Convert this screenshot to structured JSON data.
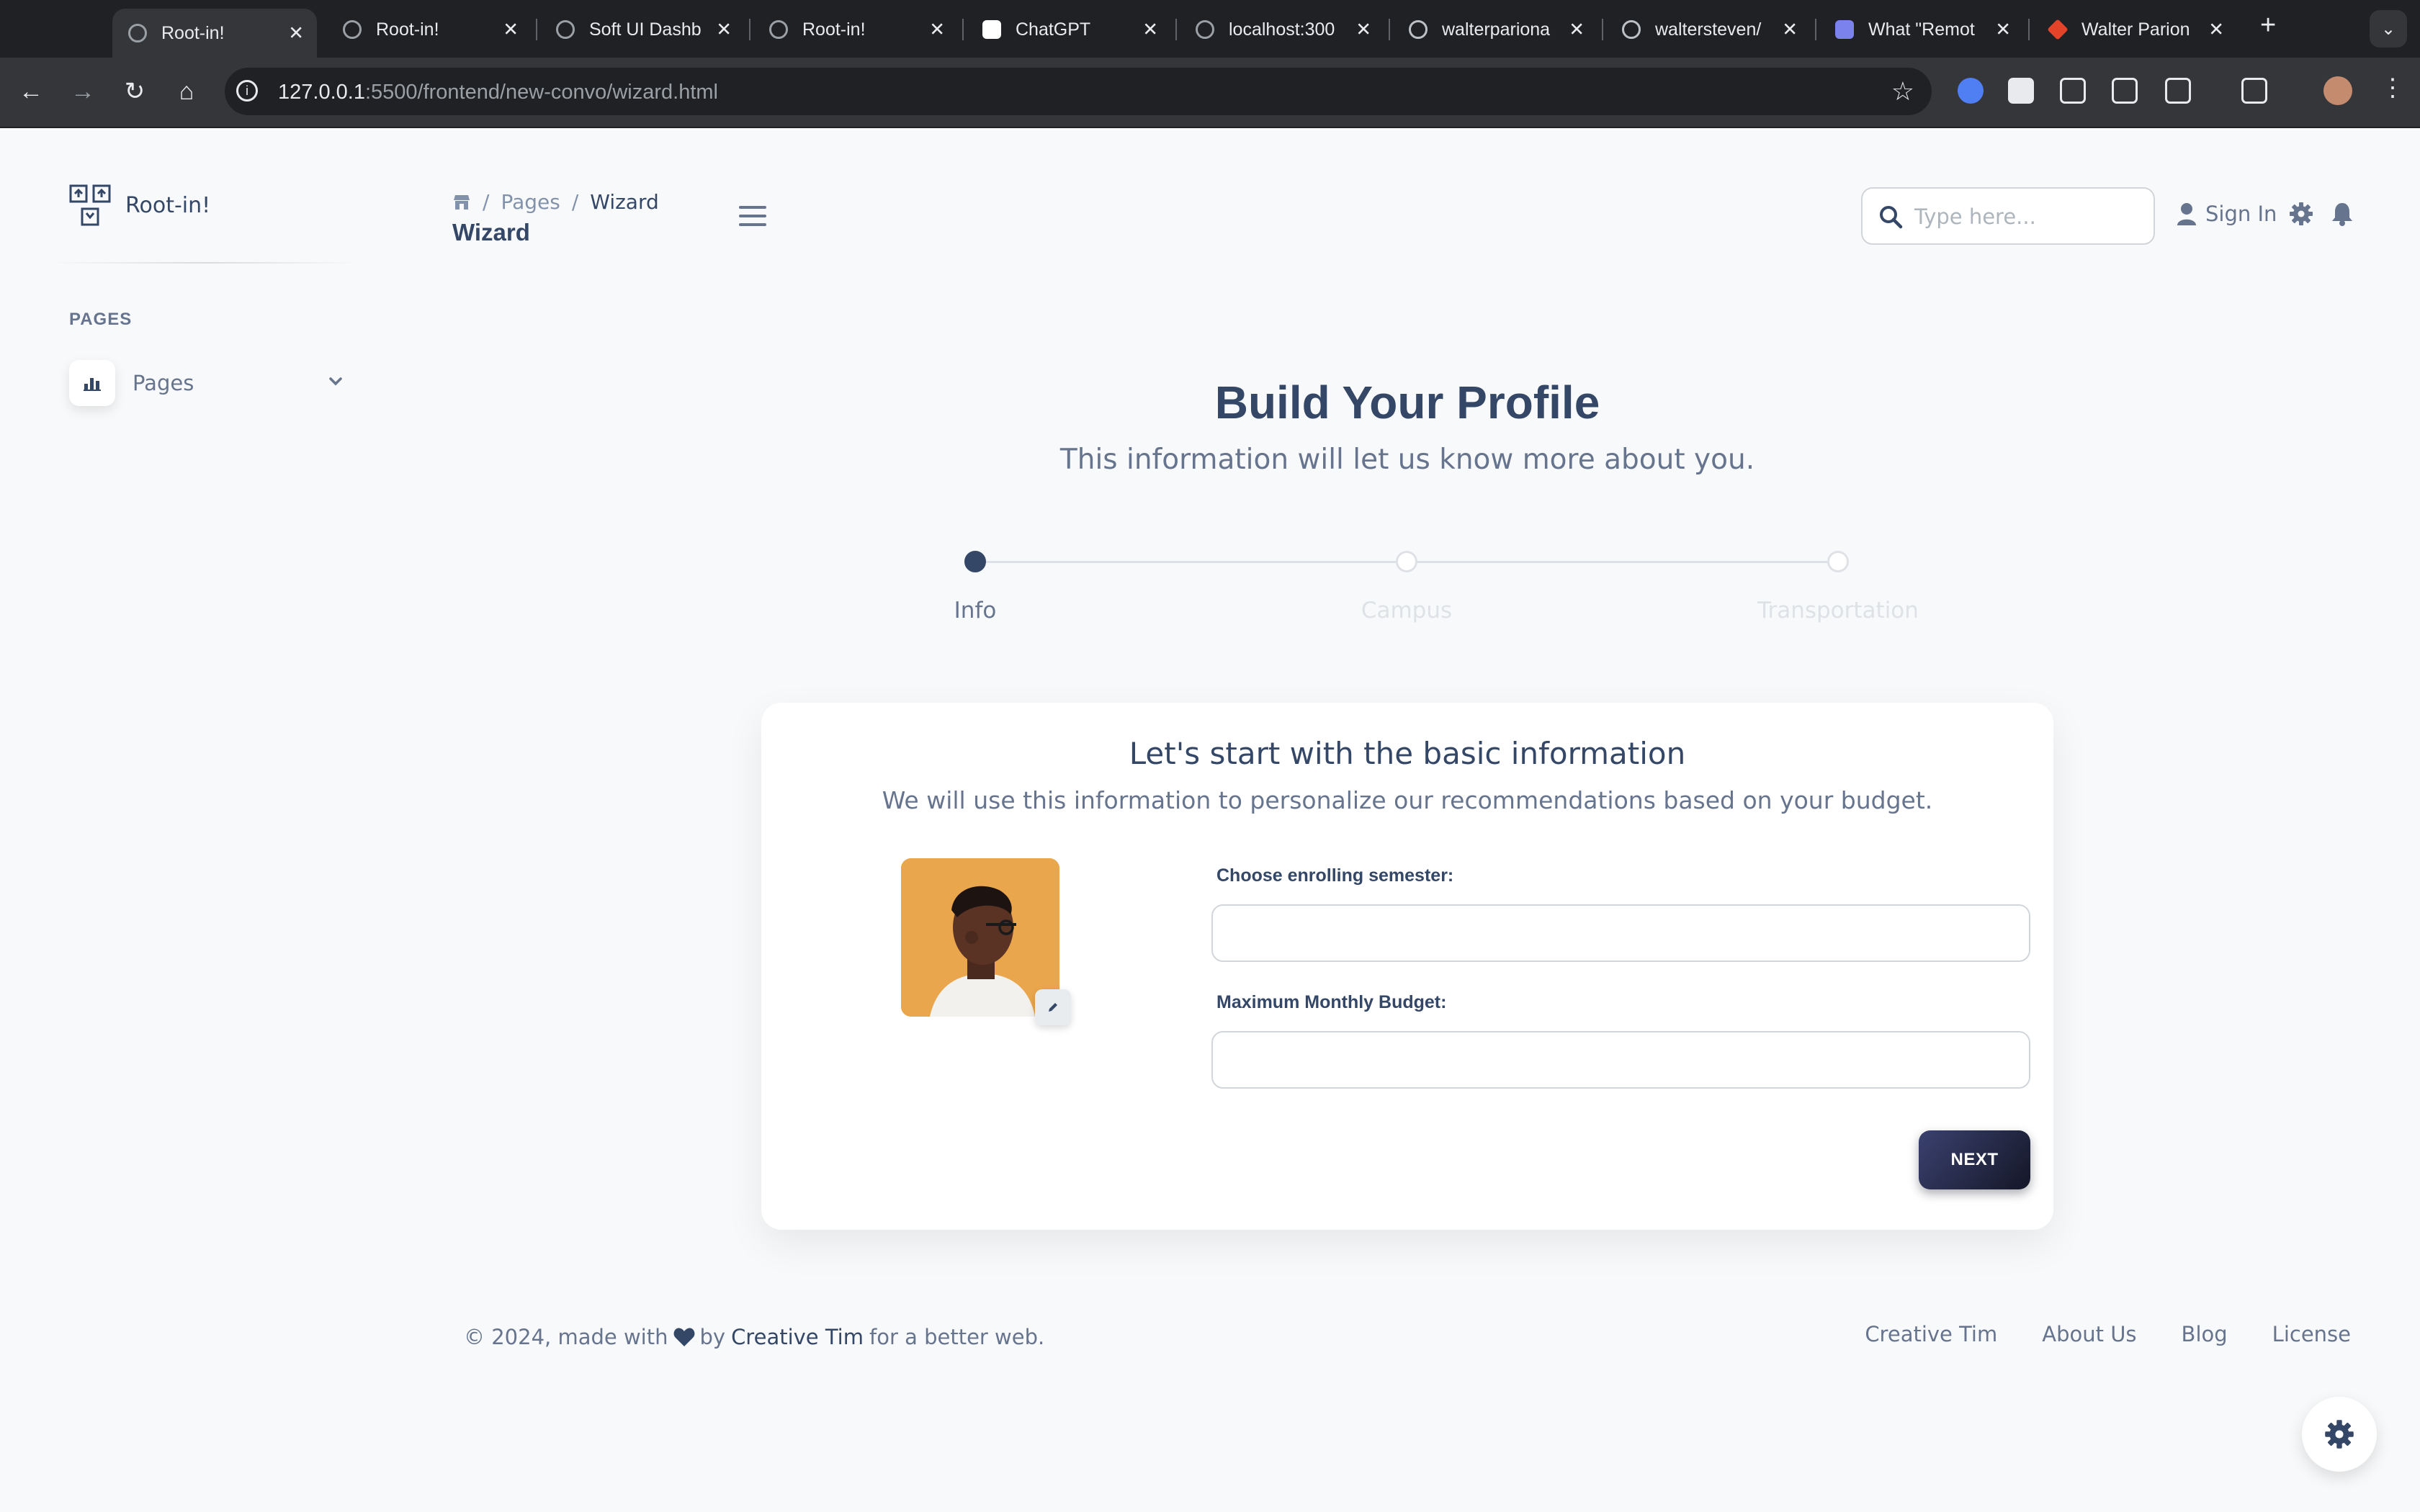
{
  "browser": {
    "tabs": [
      {
        "title": "Root-in!",
        "active": true
      },
      {
        "title": "Root-in!"
      },
      {
        "title": "Soft UI Dashb"
      },
      {
        "title": "Root-in!"
      },
      {
        "title": "ChatGPT"
      },
      {
        "title": "localhost:300"
      },
      {
        "title": "walterpariona"
      },
      {
        "title": "waltersteven/"
      },
      {
        "title": "What \"Remot"
      },
      {
        "title": "Walter Parion"
      }
    ],
    "url_host": "127.0.0.1",
    "url_rest": ":5500/frontend/new-convo/wizard.html"
  },
  "sidebar": {
    "brand": "Root-in!",
    "section": "PAGES",
    "items": [
      {
        "label": "Pages",
        "icon": "bar-chart-icon"
      }
    ]
  },
  "navbar": {
    "breadcrumb": [
      "Pages",
      "Wizard"
    ],
    "title": "Wizard",
    "search_placeholder": "Type here...",
    "sign_in": "Sign In"
  },
  "hero": {
    "title": "Build Your Profile",
    "subtitle": "This information will let us know more about you."
  },
  "steps": [
    {
      "label": "Info",
      "active": true
    },
    {
      "label": "Campus",
      "active": false
    },
    {
      "label": "Transportation",
      "active": false
    }
  ],
  "card": {
    "title": "Let's start with the basic information",
    "subtitle": "We will use this information to personalize our recommendations based on your budget.",
    "fields": [
      {
        "label": "Choose enrolling semester:",
        "value": ""
      },
      {
        "label": "Maximum Monthly Budget:",
        "value": ""
      }
    ],
    "next": "NEXT"
  },
  "footer": {
    "prefix": "© 2024, made with",
    "by": "by",
    "author": "Creative Tim",
    "suffix": "for a better web.",
    "links": [
      "Creative Tim",
      "About Us",
      "Blog",
      "License"
    ]
  },
  "colors": {
    "primary": "#344767",
    "secondary": "#67748e",
    "background": "#f8f9fa",
    "button_start": "#141727",
    "button_end": "#3a416f"
  }
}
